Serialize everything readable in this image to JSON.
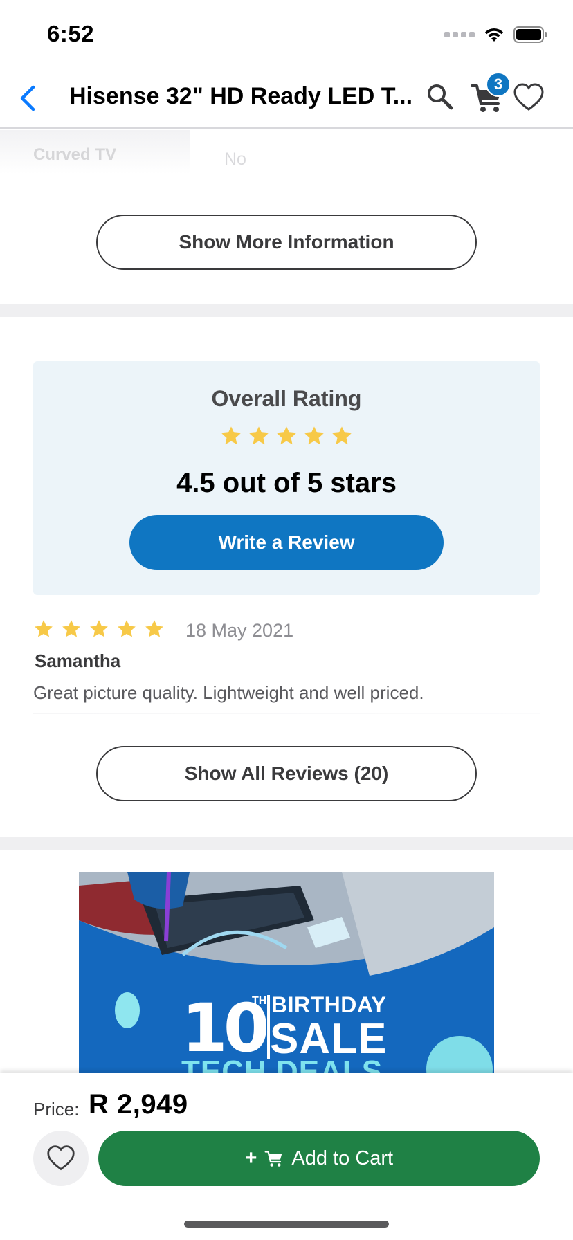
{
  "status_bar": {
    "time": "6:52"
  },
  "nav": {
    "title": "Hisense 32\" HD Ready LED T...",
    "cart_count": "3"
  },
  "spec_preview": {
    "label": "Curved TV",
    "value": "No"
  },
  "show_more_label": "Show More Information",
  "rating": {
    "heading": "Overall Rating",
    "stars": 4.5,
    "stars_max": 5,
    "summary": "4.5 out of 5 stars",
    "write_review_label": "Write a Review"
  },
  "review": {
    "stars": 5,
    "date": "18 May 2021",
    "author": "Samantha",
    "body": "Great picture quality.  Lightweight and well priced."
  },
  "show_all_reviews_label": "Show All Reviews (20)",
  "banner": {
    "number": "10",
    "superscript": "TH",
    "line1": "BIRTHDAY",
    "line2": "SALE",
    "line3": "TECH DEALS"
  },
  "bottom_bar": {
    "price_label": "Price:",
    "price_value": "R  2,949",
    "add_to_cart_label": "Add to Cart"
  },
  "colors": {
    "accent_blue": "#0f76c2",
    "star_gold": "#f7c948",
    "cart_green": "#1f8145",
    "rating_card_bg": "#ecf4f9"
  },
  "icons": [
    "back-chevron-icon",
    "search-icon",
    "cart-icon",
    "heart-icon",
    "star-icon",
    "wifi-icon",
    "battery-icon"
  ]
}
